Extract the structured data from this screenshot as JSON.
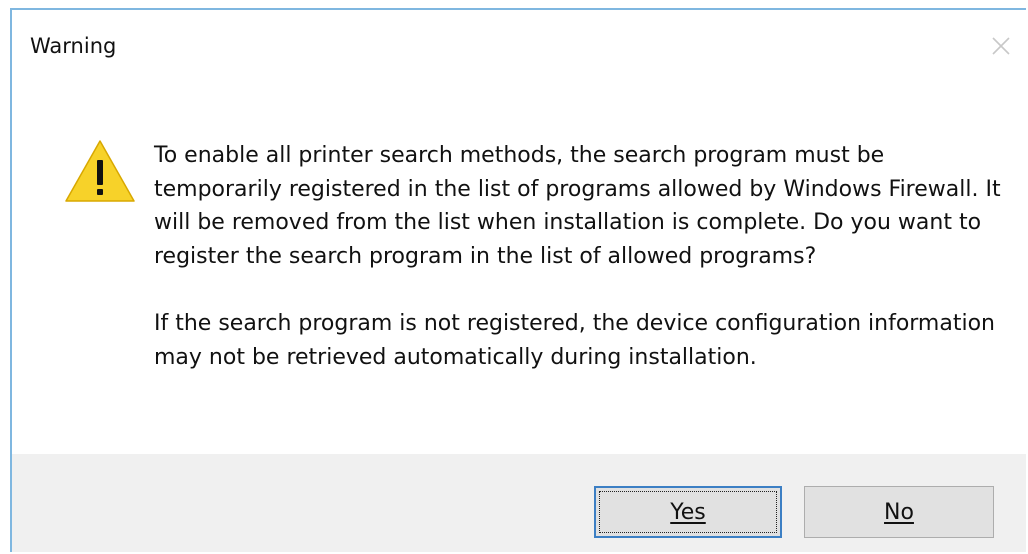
{
  "window": {
    "title": "Warning",
    "close_icon": "close-icon"
  },
  "dialog": {
    "icon": "warning-icon",
    "icon_color": "#f7d229",
    "paragraph1": "To enable all printer search methods, the search program must be temporarily registered in the list of programs allowed by Windows Firewall. It will be removed from the list when installation is complete. Do you want to register the search program in the list of allowed programs?",
    "paragraph2": "If the search program is not registered, the device configuration information may not be retrieved automatically during installation."
  },
  "buttons": {
    "yes_label": "Yes",
    "no_label": "No"
  },
  "colors": {
    "accent": "#3c7fc4",
    "window_border": "#7fb7e0",
    "footer_bg": "#f0f0f0"
  }
}
